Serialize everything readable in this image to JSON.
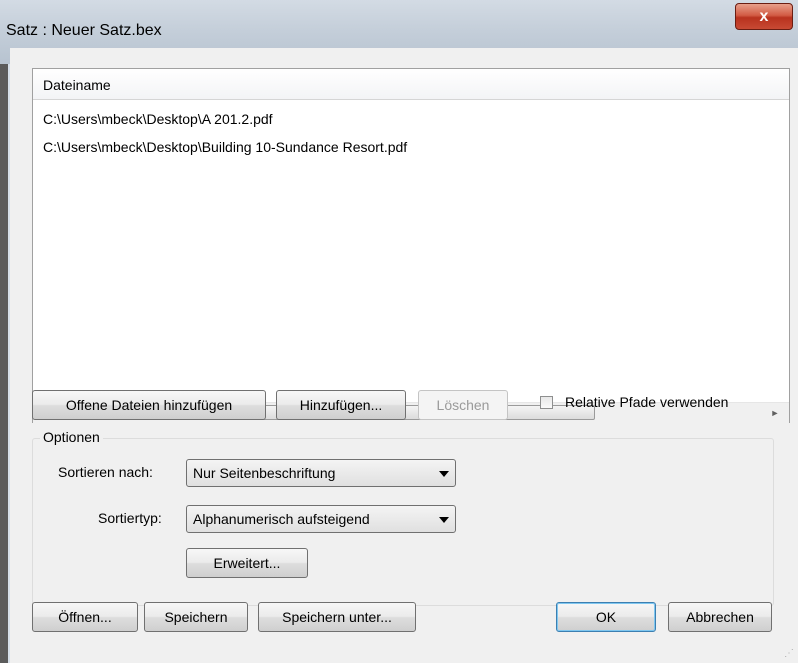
{
  "window": {
    "title": "Satz : Neuer Satz.bex",
    "close_glyph": "x"
  },
  "file_list": {
    "column_header": "Dateiname",
    "rows": [
      "C:\\Users\\mbeck\\Desktop\\A 201.2.pdf",
      "C:\\Users\\mbeck\\Desktop\\Building 10-Sundance Resort.pdf"
    ],
    "scroll_thumb_glyph": "III",
    "scroll_left_glyph": "◄",
    "scroll_right_glyph": "►"
  },
  "file_buttons": {
    "add_open": "Offene Dateien hinzufügen",
    "add": "Hinzufügen...",
    "delete": "Löschen",
    "relative_paths": "Relative Pfade verwenden"
  },
  "options": {
    "group_label": "Optionen",
    "sort_by_label": "Sortieren nach:",
    "sort_by_value": "Nur Seitenbeschriftung",
    "sort_type_label": "Sortiertyp:",
    "sort_type_value": "Alphanumerisch aufsteigend",
    "advanced": "Erweitert..."
  },
  "bottom_buttons": {
    "open": "Öffnen...",
    "save": "Speichern",
    "save_as": "Speichern unter...",
    "ok": "OK",
    "cancel": "Abbrechen"
  },
  "icons": {
    "close": "close-icon",
    "dropdown": "chevron-down-icon",
    "checkbox": "checkbox-unchecked"
  }
}
